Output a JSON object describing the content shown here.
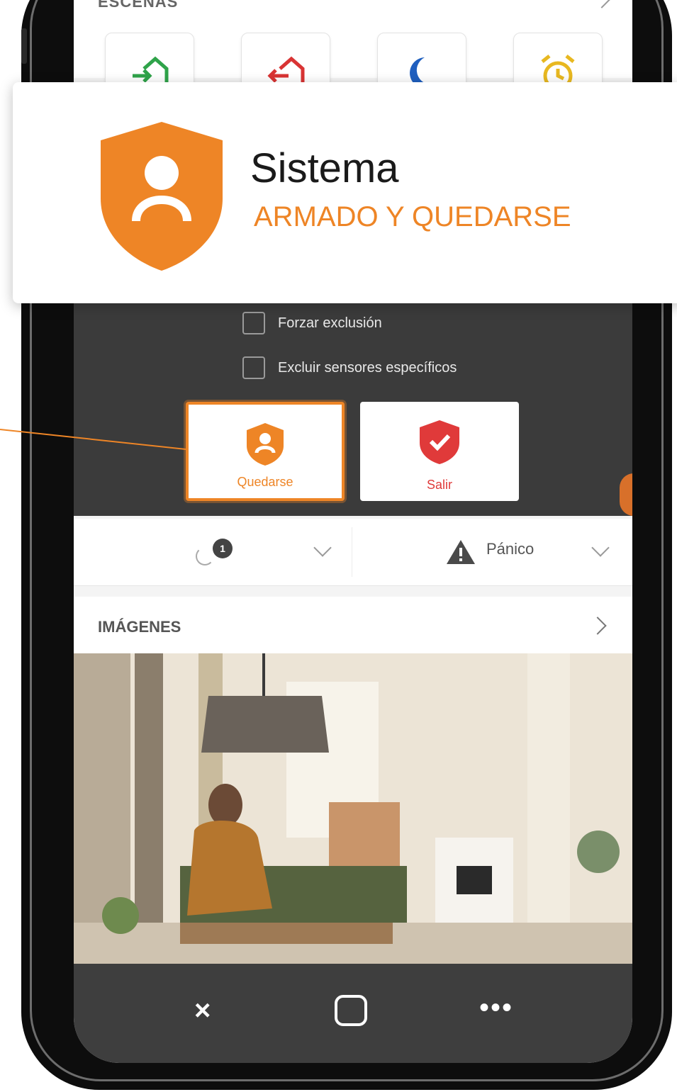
{
  "scenes": {
    "title": "ESCENAS"
  },
  "arming": {
    "force_bypass_label": "Forzar exclusión",
    "exclude_sensors_label": "Excluir sensores específicos",
    "stay_label": "Quedarse",
    "exit_label": "Salir"
  },
  "quick_bar": {
    "badge_count": "1",
    "panic_label": "Pánico"
  },
  "images": {
    "title": "IMÁGENES"
  },
  "nav": {
    "close": "×",
    "more": "•••"
  },
  "status_popup": {
    "title": "Sistema",
    "status": "ARMADO Y QUEDARSE"
  },
  "colors": {
    "accent": "#ee8526",
    "exit_red": "#e03a3a",
    "dark_panel": "#3b3b3b"
  },
  "icons": [
    "arrive-home-icon",
    "leave-home-icon",
    "moon-icon",
    "alarm-clock-icon",
    "shield-person-icon",
    "shield-check-icon",
    "warning-icon",
    "chevron-icon"
  ]
}
